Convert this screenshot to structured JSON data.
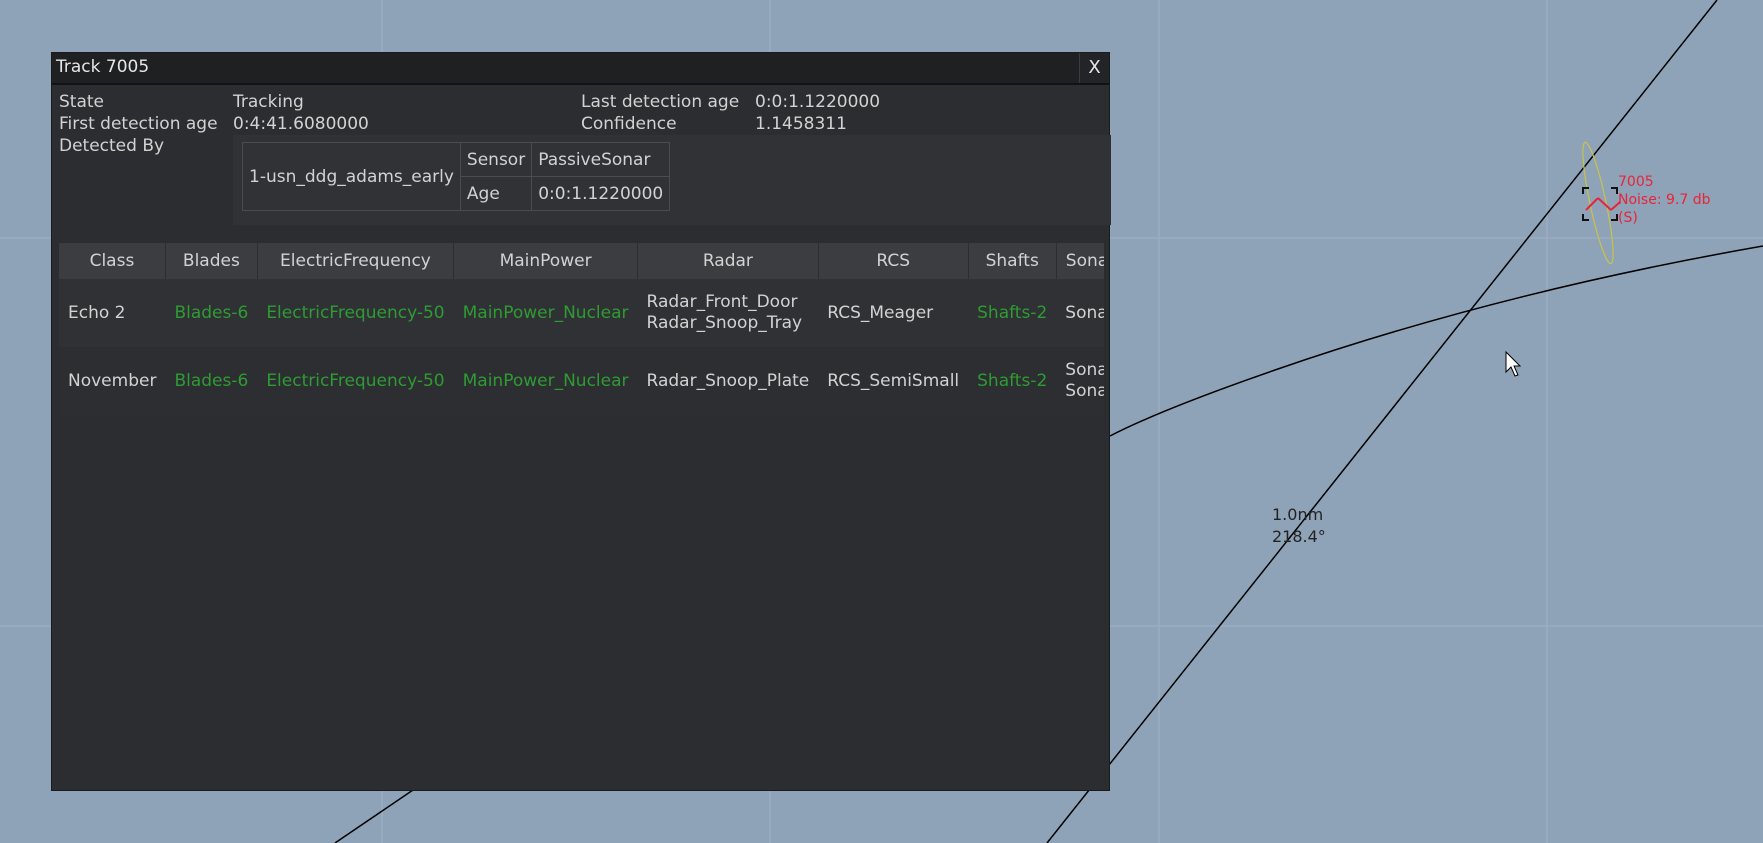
{
  "window": {
    "title": "Track 7005",
    "close_label": "X"
  },
  "details": {
    "state_label": "State",
    "state_value": "Tracking",
    "first_detection_label": "First detection age",
    "first_detection_value": "0:4:41.6080000",
    "detected_by_label": "Detected By",
    "last_detection_label": "Last detection age",
    "last_detection_value": "0:0:1.1220000",
    "confidence_label": "Confidence",
    "confidence_value": "1.1458311"
  },
  "detected_by": {
    "unit": "1-usn_ddg_adams_early",
    "sensor_label": "Sensor",
    "sensor_value": "PassiveSonar",
    "age_label": "Age",
    "age_value": "0:0:1.1220000"
  },
  "classification": {
    "columns": [
      "Class",
      "Blades",
      "ElectricFrequency",
      "MainPower",
      "Radar",
      "RCS",
      "Shafts",
      "Sona"
    ],
    "rows": [
      {
        "class": "Echo 2",
        "blades": "Blades-6",
        "electric": "ElectricFrequency-50",
        "mainpower": "MainPower_Nuclear",
        "radar_1": "Radar_Front_Door",
        "radar_2": "Radar_Snoop_Tray",
        "rcs": "RCS_Meager",
        "shafts": "Shafts-2",
        "sonar_1": "Sonar_MG",
        "sonar_2": ""
      },
      {
        "class": "November",
        "blades": "Blades-6",
        "electric": "ElectricFrequency-50",
        "mainpower": "MainPower_Nuclear",
        "radar_1": "Radar_Snoop_Plate",
        "radar_2": "",
        "rcs": "RCS_SemiSmall",
        "shafts": "Shafts-2",
        "sonar_1": "Sonar_MG",
        "sonar_2": "Sonar_MG"
      }
    ]
  },
  "map": {
    "track_id": "7005",
    "track_noise": "Noise: 9.7 db",
    "track_tag": "(S)",
    "range_text": "1.0nm",
    "bearing_text": "218.4°",
    "colors": {
      "background": "#8fa3b8",
      "track": "#e8243a",
      "ellipse": "#c8c34a",
      "grid": "#9fb1c3"
    }
  }
}
